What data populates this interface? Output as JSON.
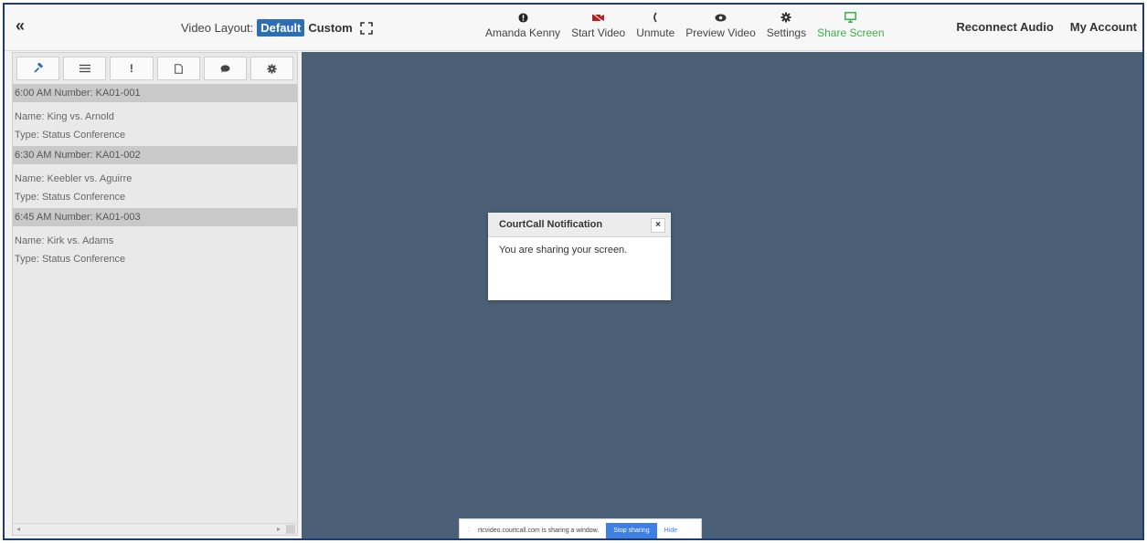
{
  "topbar": {
    "collapse_icon": "double-chevron-left-icon",
    "layout_label": "Video Layout:",
    "layout_default": "Default",
    "layout_custom": "Custom",
    "tools": [
      {
        "icon": "info-icon",
        "label": "Amanda Kenny"
      },
      {
        "icon": "video-camera-icon",
        "label": "Start Video"
      },
      {
        "icon": "phone-icon",
        "label": "Unmute"
      },
      {
        "icon": "eye-icon",
        "label": "Preview Video"
      },
      {
        "icon": "gear-icon",
        "label": "Settings"
      },
      {
        "icon": "monitor-icon",
        "label": "Share Screen"
      }
    ],
    "reconnect_audio": "Reconnect Audio",
    "my_account": "My Account"
  },
  "sidebar": {
    "tabs": [
      {
        "icon": "gavel-icon"
      },
      {
        "icon": "list-icon"
      },
      {
        "icon": "exclamation-icon"
      },
      {
        "icon": "document-icon"
      },
      {
        "icon": "chat-icon"
      },
      {
        "icon": "gear-icon"
      }
    ],
    "cases": [
      {
        "header": "6:00 AM Number: KA01-001",
        "name": "Name: King vs. Arnold",
        "type": "Type: Status Conference"
      },
      {
        "header": "6:30 AM Number: KA01-002",
        "name": "Name: Keebler vs. Aguirre",
        "type": "Type: Status Conference"
      },
      {
        "header": "6:45 AM Number: KA01-003",
        "name": "Name: Kirk vs. Adams",
        "type": "Type: Status Conference"
      }
    ]
  },
  "dialog": {
    "title": "CourtCall Notification",
    "close": "×",
    "message": "You are sharing your screen."
  },
  "sharebar": {
    "message": "rtcvideo.courtcall.com is sharing a window.",
    "stop_label": "Stop sharing",
    "hide_label": "Hide"
  },
  "colors": {
    "video_bg": "#4b6076",
    "accent": "#2c6db5",
    "share_green": "#3fae49",
    "stop_blue": "#3d7fe3"
  }
}
